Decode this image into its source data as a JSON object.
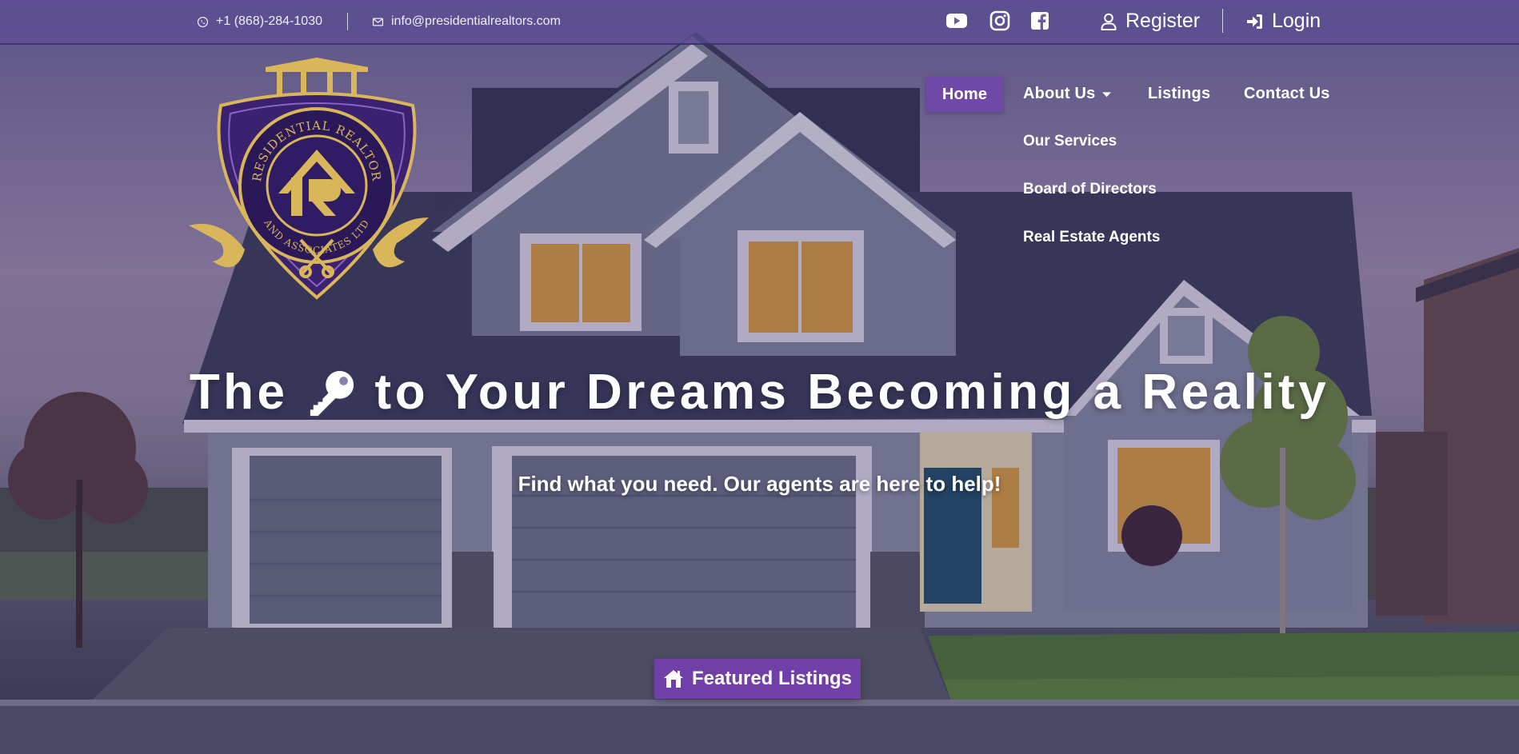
{
  "topbar": {
    "phone": "+1 (868)-284-1030",
    "email": "info@presidentialrealtors.com",
    "social": [
      {
        "name": "youtube",
        "icon": "youtube-icon"
      },
      {
        "name": "instagram",
        "icon": "instagram-icon"
      },
      {
        "name": "facebook",
        "icon": "facebook-icon"
      }
    ],
    "register_label": "Register",
    "login_label": "Login"
  },
  "logo": {
    "ring_text_top": "PRESIDENTIAL REALTORS",
    "ring_text_bottom": "AND ASSOCIATES LTD"
  },
  "nav": {
    "items": [
      {
        "label": "Home",
        "active": true
      },
      {
        "label": "About Us",
        "has_dropdown": true
      },
      {
        "label": "Listings"
      },
      {
        "label": "Contact Us"
      }
    ],
    "about_submenu": [
      "Our Services",
      "Board of Directors",
      "Real Estate Agents"
    ]
  },
  "hero": {
    "headline_before": "The",
    "headline_after": "to Your Dreams Becoming a Reality",
    "headline_icon": "key-icon",
    "subline": "Find what you need. Our agents are here to help!",
    "cta_label": "Featured Listings",
    "cta_icon": "house-icon"
  },
  "colors": {
    "accent": "#7048a8",
    "topbar": "#5c4e96",
    "gold": "#d9b65a"
  }
}
